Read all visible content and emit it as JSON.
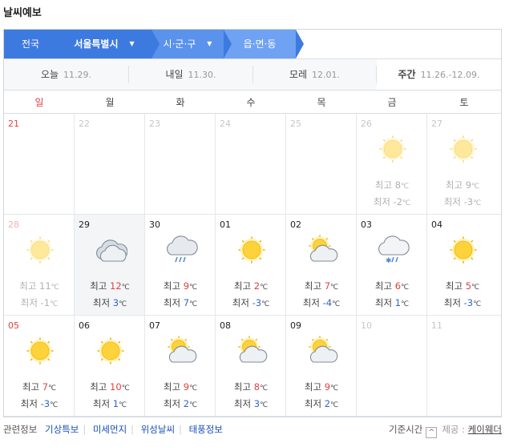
{
  "title": "날씨예보",
  "location": {
    "country": "전국",
    "city": "서울특별시",
    "district": "시·군·구",
    "town": "읍·면·동"
  },
  "tabs": [
    {
      "label": "오늘",
      "date": "11.29."
    },
    {
      "label": "내일",
      "date": "11.30."
    },
    {
      "label": "모레",
      "date": "12.01."
    },
    {
      "label": "주간",
      "date": "11.26.-12.09."
    }
  ],
  "weekdays": [
    "일",
    "월",
    "화",
    "수",
    "목",
    "금",
    "토"
  ],
  "temp_labels": {
    "high": "최고",
    "low": "최저",
    "unit": "℃"
  },
  "weeks": [
    [
      {
        "day": "21"
      },
      {
        "day": "22"
      },
      {
        "day": "23"
      },
      {
        "day": "24"
      },
      {
        "day": "25"
      },
      {
        "day": "26",
        "icon": "sun-icon",
        "high": "8",
        "low": "-2"
      },
      {
        "day": "27",
        "icon": "sun-icon",
        "high": "9",
        "low": "-3"
      }
    ],
    [
      {
        "day": "28",
        "icon": "sun-icon",
        "high": "11",
        "low": "-1"
      },
      {
        "day": "29",
        "icon": "cloud-icon",
        "high": "12",
        "low": "3"
      },
      {
        "day": "30",
        "icon": "rain-icon",
        "high": "9",
        "low": "7"
      },
      {
        "day": "01",
        "icon": "sun-icon",
        "high": "2",
        "low": "-3"
      },
      {
        "day": "02",
        "icon": "partly-cloudy-icon",
        "high": "7",
        "low": "-4"
      },
      {
        "day": "03",
        "icon": "snow-rain-icon",
        "high": "6",
        "low": "1"
      },
      {
        "day": "04",
        "icon": "sun-icon",
        "high": "5",
        "low": "-3"
      }
    ],
    [
      {
        "day": "05",
        "icon": "sun-icon",
        "high": "7",
        "low": "-3"
      },
      {
        "day": "06",
        "icon": "sun-icon",
        "high": "10",
        "low": "1"
      },
      {
        "day": "07",
        "icon": "partly-cloudy-icon",
        "high": "9",
        "low": "2"
      },
      {
        "day": "08",
        "icon": "partly-cloudy-icon",
        "high": "8",
        "low": "3"
      },
      {
        "day": "09",
        "icon": "partly-cloudy-icon",
        "high": "9",
        "low": "2"
      },
      {
        "day": "10"
      },
      {
        "day": "11"
      }
    ]
  ],
  "footer": {
    "related_label": "관련정보",
    "links": [
      "기상특보",
      "미세먼지",
      "위성날씨",
      "태풍정보"
    ],
    "base_time_label": "기준시간",
    "provider_label": "제공 :",
    "provider_name": "케이웨더"
  },
  "colors": {
    "accent": "#3d7ae0",
    "sunday": "#e04141",
    "high_temp": "#e04141",
    "low_temp": "#3366cc",
    "sun": "#fdd23a"
  }
}
